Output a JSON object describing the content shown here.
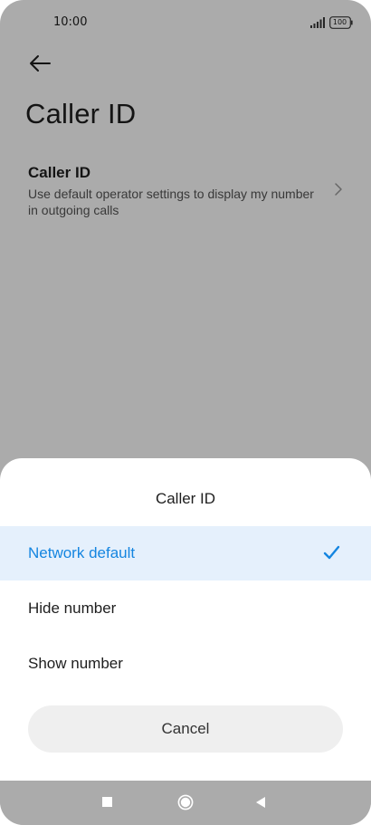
{
  "status_bar": {
    "time": "10:00",
    "battery": "100",
    "icons": [
      "dot-icon",
      "signal-icon",
      "battery-icon"
    ]
  },
  "header": {
    "back_icon": "back-arrow-icon",
    "title": "Caller ID"
  },
  "setting": {
    "title": "Caller ID",
    "description": "Use default operator settings to display my number in outgoing calls",
    "icon": "chevron-right-icon"
  },
  "sheet": {
    "title": "Caller ID",
    "options": [
      {
        "label": "Network default",
        "selected": true
      },
      {
        "label": "Hide number",
        "selected": false
      },
      {
        "label": "Show number",
        "selected": false
      }
    ],
    "cancel_label": "Cancel"
  },
  "nav_bar": {
    "icons": [
      "recents-square-icon",
      "home-circle-icon",
      "back-triangle-icon"
    ]
  },
  "colors": {
    "accent": "#1485e0",
    "selected_row": "#e5f0fc",
    "scrim": "#000000",
    "cancel_button": "#efefef"
  }
}
